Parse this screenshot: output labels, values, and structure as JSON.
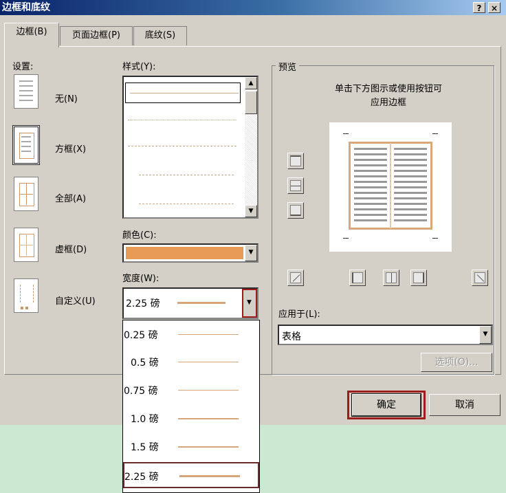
{
  "window": {
    "title": "边框和底纹",
    "help_label": "?",
    "close_label": "×"
  },
  "tabs": [
    {
      "label": "边框(B)",
      "active": true
    },
    {
      "label": "页面边框(P)",
      "active": false
    },
    {
      "label": "底纹(S)",
      "active": false
    }
  ],
  "settings": {
    "group_label": "设置:",
    "items": [
      {
        "label": "无(N)",
        "icon": "no-border-icon"
      },
      {
        "label": "方框(X)",
        "icon": "box-border-icon",
        "selected": true
      },
      {
        "label": "全部(A)",
        "icon": "all-borders-icon"
      },
      {
        "label": "虚框(D)",
        "icon": "grid-border-icon"
      },
      {
        "label": "自定义(U)",
        "icon": "custom-border-icon"
      }
    ]
  },
  "style": {
    "label": "样式(Y):"
  },
  "color": {
    "label": "颜色(C):",
    "value": "#e89b55"
  },
  "width": {
    "label": "宽度(W):",
    "value": "2.25 磅",
    "options": [
      "0.25 磅",
      "0.5 磅",
      "0.75 磅",
      "1.0 磅",
      "1.5 磅",
      "2.25 磅"
    ],
    "selected_index": 5
  },
  "preview": {
    "group_label": "预览",
    "hint_line1": "单击下方图示或使用按钮可",
    "hint_line2": "应用边框"
  },
  "apply_to": {
    "label": "应用于(L):",
    "value": "表格"
  },
  "buttons": {
    "options": "选项(O)...",
    "ok": "确定",
    "cancel": "取消"
  },
  "colors": {
    "border_color": "#e89b55",
    "highlight": "#9c1c1c",
    "background": "#cbe9d2"
  }
}
